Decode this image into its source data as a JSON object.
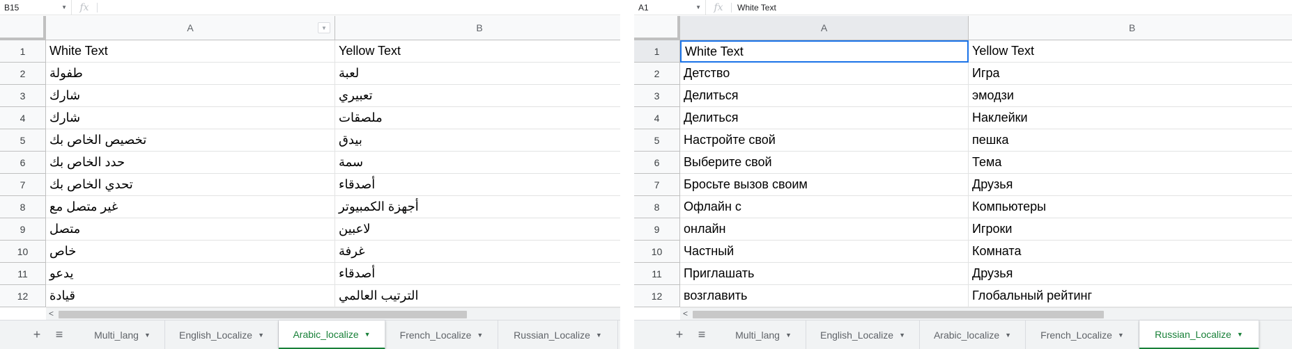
{
  "left": {
    "name_box": "B15",
    "formula_fx": "fx",
    "formula_value": "",
    "columns": [
      "A",
      "B"
    ],
    "rows": [
      {
        "n": "1",
        "a": "White Text",
        "b": "Yellow Text"
      },
      {
        "n": "2",
        "a": "طفولة",
        "b": "لعبة"
      },
      {
        "n": "3",
        "a": "شارك",
        "b": "تعبيري"
      },
      {
        "n": "4",
        "a": "شارك",
        "b": "ملصقات"
      },
      {
        "n": "5",
        "a": "تخصيص الخاص بك",
        "b": "بيدق"
      },
      {
        "n": "6",
        "a": "حدد الخاص بك",
        "b": "سمة"
      },
      {
        "n": "7",
        "a": "تحدي الخاص بك",
        "b": "أصدقاء"
      },
      {
        "n": "8",
        "a": "غير متصل مع",
        "b": "أجهزة الكمبيوتر"
      },
      {
        "n": "9",
        "a": "متصل",
        "b": "لاعبين"
      },
      {
        "n": "10",
        "a": "خاص",
        "b": "غرفة"
      },
      {
        "n": "11",
        "a": "يدعو",
        "b": "أصدقاء"
      },
      {
        "n": "12",
        "a": "قيادة",
        "b": "الترتيب العالمي"
      }
    ],
    "tabs": [
      {
        "label": "Multi_lang",
        "active": false
      },
      {
        "label": "English_Localize",
        "active": false
      },
      {
        "label": "Arabic_localize",
        "active": true
      },
      {
        "label": "French_Localize",
        "active": false
      },
      {
        "label": "Russian_Localize",
        "active": false
      }
    ]
  },
  "right": {
    "name_box": "A1",
    "formula_fx": "fx",
    "formula_value": "White Text",
    "columns": [
      "A",
      "B"
    ],
    "rows": [
      {
        "n": "1",
        "a": "White Text",
        "b": "Yellow Text"
      },
      {
        "n": "2",
        "a": "Детство",
        "b": "Игра"
      },
      {
        "n": "3",
        "a": "Делиться",
        "b": "эмодзи"
      },
      {
        "n": "4",
        "a": "Делиться",
        "b": "Наклейки"
      },
      {
        "n": "5",
        "a": "Настройте свой",
        "b": "пешка"
      },
      {
        "n": "6",
        "a": "Выберите свой",
        "b": "Тема"
      },
      {
        "n": "7",
        "a": "Бросьте вызов своим",
        "b": "Друзья"
      },
      {
        "n": "8",
        "a": "Офлайн с",
        "b": "Компьютеры"
      },
      {
        "n": "9",
        "a": "онлайн",
        "b": "Игроки"
      },
      {
        "n": "10",
        "a": "Частный",
        "b": "Комната"
      },
      {
        "n": "11",
        "a": "Приглашать",
        "b": "Друзья"
      },
      {
        "n": "12",
        "a": "возглавить",
        "b": "Глобальный рейтинг"
      }
    ],
    "tabs": [
      {
        "label": "Multi_lang",
        "active": false
      },
      {
        "label": "English_Localize",
        "active": false
      },
      {
        "label": "Arabic_localize",
        "active": false
      },
      {
        "label": "French_Localize",
        "active": false
      },
      {
        "label": "Russian_Localize",
        "active": true
      }
    ]
  },
  "icons": {
    "add_sheet": "+",
    "all_sheets": "≡",
    "dropdown": "▼",
    "scroll_left": "<"
  }
}
